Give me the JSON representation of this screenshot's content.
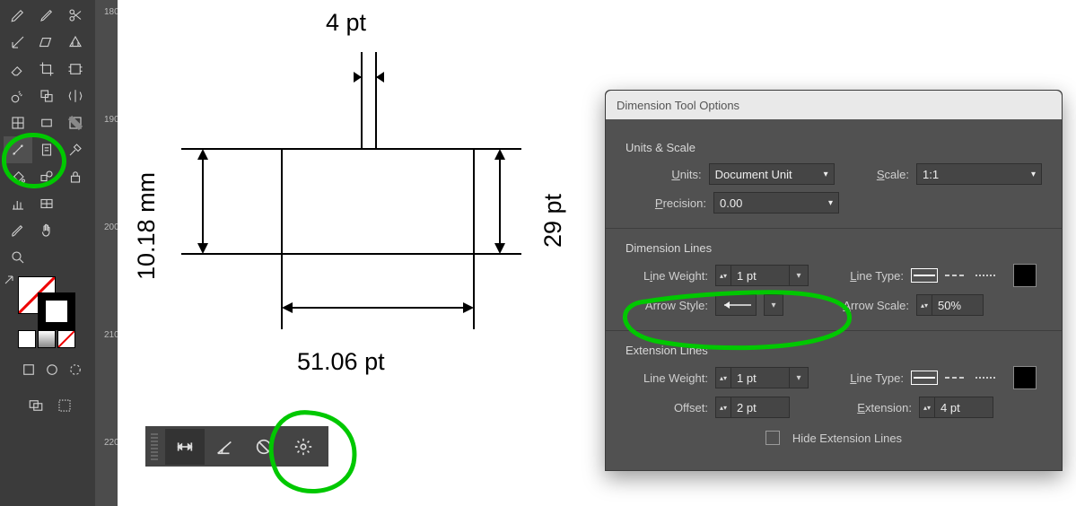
{
  "app": {
    "dialog_title": "Dimension Tool Options"
  },
  "ruler": {
    "ticks": [
      "180",
      "190",
      "200",
      "210",
      "220"
    ]
  },
  "dims": {
    "top": "4 pt",
    "left": "10.18 mm",
    "right": "29 pt",
    "bottom": "51.06 pt"
  },
  "options": {
    "units_scale_title": "Units & Scale",
    "units_label": "Units:",
    "units_underline": "U",
    "units_value": "Document Unit",
    "scale_label": "Scale:",
    "scale_underline": "S",
    "scale_value": "1:1",
    "precision_label": "Precision:",
    "precision_underline": "P",
    "precision_value": "0.00",
    "dim_lines_title": "Dimension Lines",
    "line_weight_label": "Line Weight:",
    "line_weight_underline": "i",
    "line_weight_value": "1 pt",
    "line_type_label": "Line Type:",
    "line_type_underline": "L",
    "arrow_style_label": "Arrow Style:",
    "arrow_scale_label": "Arrow Scale:",
    "arrow_scale_underline": "A",
    "arrow_scale_value": "50%",
    "ext_lines_title": "Extension Lines",
    "ext_line_weight_label": "Line Weight:",
    "ext_line_weight_value": "1 pt",
    "ext_line_type_label": "Line Type:",
    "ext_line_type_underline": "L",
    "offset_label": "Offset:",
    "offset_value": "2 pt",
    "extension_label": "Extension:",
    "extension_underline": "E",
    "extension_value": "4 pt",
    "hide_ext_label": "Hide Extension Lines",
    "hide_ext_underline": "d"
  },
  "strip": {
    "items": [
      "linear-dimension",
      "angle-dimension",
      "label-dimension",
      "settings"
    ]
  },
  "chart_data": {
    "type": "diagram",
    "rectangle": {
      "width_pt": 51.06,
      "height_pt": 29,
      "height_mm": 10.18,
      "top_gap_pt": 4
    }
  }
}
